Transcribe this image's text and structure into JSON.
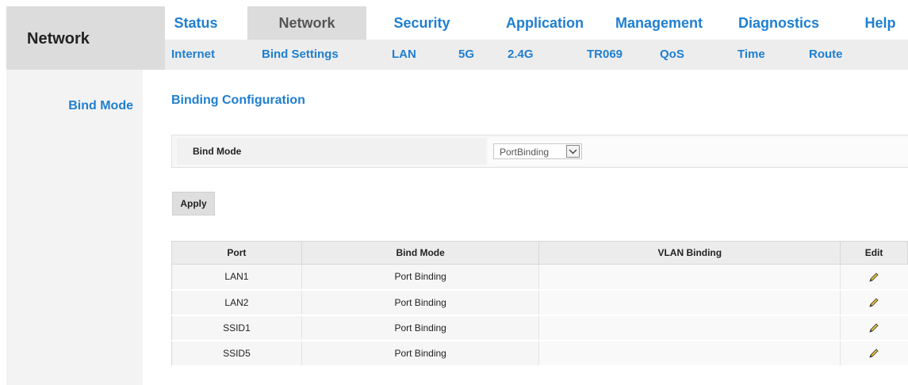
{
  "header": {
    "title": "Network"
  },
  "main_nav": [
    {
      "label": "Status",
      "active": false
    },
    {
      "label": "Network",
      "active": true
    },
    {
      "label": "Security",
      "active": false
    },
    {
      "label": "Application",
      "active": false
    },
    {
      "label": "Management",
      "active": false
    },
    {
      "label": "Diagnostics",
      "active": false
    },
    {
      "label": "Help",
      "active": false
    }
  ],
  "sub_nav": [
    "Internet",
    "Bind Settings",
    "LAN",
    "5G",
    "2.4G",
    "TR069",
    "QoS",
    "Time",
    "Route"
  ],
  "sidebar": {
    "items": [
      {
        "label": "Bind Mode"
      }
    ]
  },
  "content": {
    "title": "Binding Configuration",
    "bind_mode_label": "Bind Mode",
    "bind_mode_value": "PortBinding",
    "apply_label": "Apply"
  },
  "table": {
    "columns": [
      "Port",
      "Bind Mode",
      "VLAN Binding",
      "Edit"
    ],
    "rows": [
      {
        "port": "LAN1",
        "bind_mode": "Port Binding",
        "vlan": ""
      },
      {
        "port": "LAN2",
        "bind_mode": "Port Binding",
        "vlan": ""
      },
      {
        "port": "SSID1",
        "bind_mode": "Port Binding",
        "vlan": ""
      },
      {
        "port": "SSID5",
        "bind_mode": "Port Binding",
        "vlan": ""
      }
    ]
  },
  "colors": {
    "accent": "#1f7fd0",
    "edit_icon": "#d4a017"
  },
  "icons": {
    "edit": "pencil-icon",
    "dropdown": "chevron-down-icon"
  }
}
